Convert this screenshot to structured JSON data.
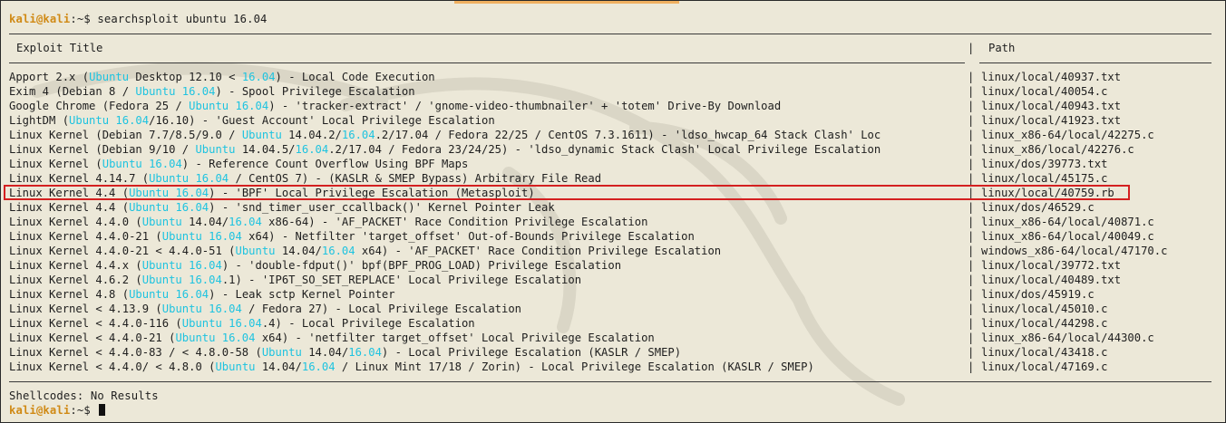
{
  "colors": {
    "background": "#ece8d8",
    "prompt_user": "#d08a16",
    "keyword_highlight": "#1ec3e0",
    "text": "#1e1e1e",
    "selection_box": "#d42020"
  },
  "prompt": {
    "user_host": "kali@kali",
    "path": ":~$",
    "command": "searchsploit ubuntu 16.04"
  },
  "table": {
    "title_header": "Exploit Title",
    "path_header": "Path",
    "column_separator": "|",
    "rows": [
      {
        "title": [
          [
            "Apport 2.x (",
            0
          ],
          [
            "Ubuntu",
            1
          ],
          [
            " Desktop 12.10 < ",
            0
          ],
          [
            "16.04",
            1
          ],
          [
            ") - Local Code Execution",
            0
          ]
        ],
        "path": "linux/local/40937.txt"
      },
      {
        "title": [
          [
            "Exim 4 (Debian 8 / ",
            0
          ],
          [
            "Ubuntu 16.04",
            1
          ],
          [
            ") - Spool Privilege Escalation",
            0
          ]
        ],
        "path": "linux/local/40054.c"
      },
      {
        "title": [
          [
            "Google Chrome (Fedora 25 / ",
            0
          ],
          [
            "Ubuntu 16.04",
            1
          ],
          [
            ") - 'tracker-extract' / 'gnome-video-thumbnailer' + 'totem' Drive-By Download",
            0
          ]
        ],
        "path": "linux/local/40943.txt"
      },
      {
        "title": [
          [
            "LightDM (",
            0
          ],
          [
            "Ubuntu 16.04",
            1
          ],
          [
            "/16.10) - 'Guest Account' Local Privilege Escalation",
            0
          ]
        ],
        "path": "linux/local/41923.txt"
      },
      {
        "title": [
          [
            "Linux Kernel (Debian 7.7/8.5/9.0 / ",
            0
          ],
          [
            "Ubuntu",
            1
          ],
          [
            " 14.04.2/",
            0
          ],
          [
            "16.04",
            1
          ],
          [
            ".2/17.04 / Fedora 22/25 / CentOS 7.3.1611) - 'ldso_hwcap_64 Stack Clash' Loc",
            0
          ]
        ],
        "path": "linux_x86-64/local/42275.c"
      },
      {
        "title": [
          [
            "Linux Kernel (Debian 9/10 / ",
            0
          ],
          [
            "Ubuntu",
            1
          ],
          [
            " 14.04.5/",
            0
          ],
          [
            "16.04",
            1
          ],
          [
            ".2/17.04 / Fedora 23/24/25) - 'ldso_dynamic Stack Clash' Local Privilege Escalation",
            0
          ]
        ],
        "path": "linux_x86/local/42276.c"
      },
      {
        "title": [
          [
            "Linux Kernel (",
            0
          ],
          [
            "Ubuntu 16.04",
            1
          ],
          [
            ") - Reference Count Overflow Using BPF Maps",
            0
          ]
        ],
        "path": "linux/dos/39773.txt"
      },
      {
        "title": [
          [
            "Linux Kernel 4.14.7 (",
            0
          ],
          [
            "Ubuntu 16.04",
            1
          ],
          [
            " / CentOS 7) - (KASLR & SMEP Bypass) Arbitrary File Read",
            0
          ]
        ],
        "path": "linux/local/45175.c"
      },
      {
        "title": [
          [
            "Linux Kernel 4.4 (",
            0
          ],
          [
            "Ubuntu 16.04",
            1
          ],
          [
            ") - 'BPF' Local Privilege Escalation (Metasploit)",
            0
          ]
        ],
        "path": "linux/local/40759.rb"
      },
      {
        "title": [
          [
            "Linux Kernel 4.4 (",
            0
          ],
          [
            "Ubuntu 16.04",
            1
          ],
          [
            ") - 'snd_timer_user_ccallback()' Kernel Pointer Leak",
            0
          ]
        ],
        "path": "linux/dos/46529.c"
      },
      {
        "title": [
          [
            "Linux Kernel 4.4.0 (",
            0
          ],
          [
            "Ubuntu",
            1
          ],
          [
            " 14.04/",
            0
          ],
          [
            "16.04",
            1
          ],
          [
            " x86-64) - 'AF_PACKET' Race Condition Privilege Escalation",
            0
          ]
        ],
        "path": "linux_x86-64/local/40871.c"
      },
      {
        "title": [
          [
            "Linux Kernel 4.4.0-21 (",
            0
          ],
          [
            "Ubuntu 16.04",
            1
          ],
          [
            " x64) - Netfilter 'target_offset' Out-of-Bounds Privilege Escalation",
            0
          ]
        ],
        "path": "linux_x86-64/local/40049.c"
      },
      {
        "title": [
          [
            "Linux Kernel 4.4.0-21 < 4.4.0-51 (",
            0
          ],
          [
            "Ubuntu",
            1
          ],
          [
            " 14.04/",
            0
          ],
          [
            "16.04",
            1
          ],
          [
            " x64) - 'AF_PACKET' Race Condition Privilege Escalation",
            0
          ]
        ],
        "path": "windows_x86-64/local/47170.c"
      },
      {
        "title": [
          [
            "Linux Kernel 4.4.x (",
            0
          ],
          [
            "Ubuntu 16.04",
            1
          ],
          [
            ") - 'double-fdput()' bpf(BPF_PROG_LOAD) Privilege Escalation",
            0
          ]
        ],
        "path": "linux/local/39772.txt"
      },
      {
        "title": [
          [
            "Linux Kernel 4.6.2 (",
            0
          ],
          [
            "Ubuntu 16.04",
            1
          ],
          [
            ".1) - 'IP6T_SO_SET_REPLACE' Local Privilege Escalation",
            0
          ]
        ],
        "path": "linux/local/40489.txt"
      },
      {
        "title": [
          [
            "Linux Kernel 4.8 (",
            0
          ],
          [
            "Ubuntu 16.04",
            1
          ],
          [
            ") - Leak sctp Kernel Pointer",
            0
          ]
        ],
        "path": "linux/dos/45919.c"
      },
      {
        "title": [
          [
            "Linux Kernel < 4.13.9 (",
            0
          ],
          [
            "Ubuntu 16.04",
            1
          ],
          [
            " / Fedora 27) - Local Privilege Escalation",
            0
          ]
        ],
        "path": "linux/local/45010.c"
      },
      {
        "title": [
          [
            "Linux Kernel < 4.4.0-116 (",
            0
          ],
          [
            "Ubuntu 16.04",
            1
          ],
          [
            ".4) - Local Privilege Escalation",
            0
          ]
        ],
        "path": "linux/local/44298.c"
      },
      {
        "title": [
          [
            "Linux Kernel < 4.4.0-21 (",
            0
          ],
          [
            "Ubuntu 16.04",
            1
          ],
          [
            " x64) - 'netfilter target_offset' Local Privilege Escalation",
            0
          ]
        ],
        "path": "linux_x86-64/local/44300.c"
      },
      {
        "title": [
          [
            "Linux Kernel < 4.4.0-83 / < 4.8.0-58 (",
            0
          ],
          [
            "Ubuntu",
            1
          ],
          [
            " 14.04/",
            0
          ],
          [
            "16.04",
            1
          ],
          [
            ") - Local Privilege Escalation (KASLR / SMEP)",
            0
          ]
        ],
        "path": "linux/local/43418.c"
      },
      {
        "title": [
          [
            "Linux Kernel < 4.4.0/ < 4.8.0 (",
            0
          ],
          [
            "Ubuntu",
            1
          ],
          [
            " 14.04/",
            0
          ],
          [
            "16.04",
            1
          ],
          [
            " / Linux Mint 17/18 / Zorin) - Local Privilege Escalation (KASLR / SMEP)",
            0
          ]
        ],
        "path": "linux/local/47169.c"
      }
    ]
  },
  "shellcodes": "Shellcodes: No Results",
  "final_prompt": {
    "user_host": "kali@kali",
    "path": ":~$"
  }
}
